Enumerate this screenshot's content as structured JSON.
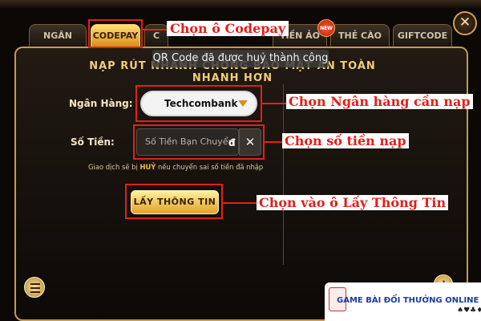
{
  "tabs": [
    {
      "label": "NGÂN HÀNG"
    },
    {
      "label": "CODEPAY"
    },
    {
      "label": "C"
    },
    {
      "label": "TIỀN ẢO"
    },
    {
      "label": "THẺ CÀO"
    },
    {
      "label": "GIFTCODE"
    }
  ],
  "new_badge": "NEW",
  "close_label": "✕",
  "panel": {
    "title": "NẠP RÚT NHANH CHÓNG BẢO MẬT AN TOÀN NHANH HƠN",
    "toast": "QR Code đã được huỷ thành công"
  },
  "form": {
    "bank_label": "Ngân Hàng:",
    "bank_value": "Techcombank",
    "amount_label": "Số Tiền:",
    "amount_placeholder": "Số Tiền Bạn Chuyển",
    "currency_suffix": "đ",
    "clear_icon": "✕",
    "warning_prefix": "Giao dịch sẽ bị ",
    "warning_strong": "HUỶ",
    "warning_suffix": " nếu chuyển sai số tiền đã nhập",
    "submit_label": "LẤY THÔNG TIN"
  },
  "annotations": {
    "codepay": "Chọn ô Codepay",
    "bank": "Chọn Ngân hàng cần nạp",
    "amount": "Chọn số tiền nạp",
    "submit": "Chọn vào ô Lấy Thông Tin"
  },
  "watermark": {
    "text": "GAME BÀI ĐỔI THƯỞNG ONLINE",
    "suits": "♠♥♣♦"
  },
  "colors": {
    "accent_gold": "#d98f1a",
    "annotation_red": "#e2201c",
    "panel_border": "#c59a4c"
  },
  "icons": {
    "close": "close-icon",
    "dropdown": "chevron-down-icon",
    "clear": "clear-icon",
    "menu": "menu-icon",
    "key": "key-icon"
  }
}
